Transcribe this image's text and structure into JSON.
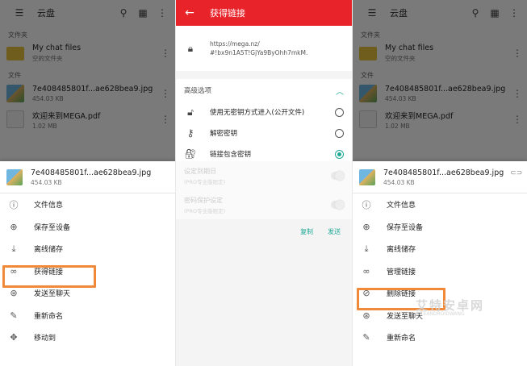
{
  "left": {
    "topbar": {
      "title": "云盘"
    },
    "folders_label": "文件夹",
    "folder": {
      "name": "My chat files",
      "meta": "空的文件夹"
    },
    "files_label": "文件",
    "files": [
      {
        "name": "7e408485801f...ae628bea9.jpg",
        "meta": "454.03 KB"
      },
      {
        "name": "欢迎来到MEGA.pdf",
        "meta": "1.02 MB"
      }
    ],
    "sheet": {
      "file_name": "7e408485801f...ae628bea9.jpg",
      "file_size": "454.03 KB",
      "items": [
        {
          "icon": "info-icon",
          "label": "文件信息"
        },
        {
          "icon": "download-icon",
          "label": "保存至设备"
        },
        {
          "icon": "offline-icon",
          "label": "离线储存"
        },
        {
          "icon": "link-icon",
          "label": "获得链接"
        },
        {
          "icon": "send-icon",
          "label": "发送至聊天"
        },
        {
          "icon": "rename-icon",
          "label": "重新命名"
        },
        {
          "icon": "move-icon",
          "label": "移动到"
        }
      ]
    }
  },
  "middle": {
    "title": "获得链接",
    "link_line1": "https://mega.nz/",
    "link_line2": "#!bx9n1A5T!GjYa9ByOhh7mkM.",
    "advanced_label": "高级选项",
    "options": [
      {
        "label": "使用无密钥方式进入(公开文件)",
        "selected": false
      },
      {
        "label": "解密密钥",
        "selected": false
      },
      {
        "label": "链接包含密钥",
        "selected": true
      }
    ],
    "pro_options": [
      {
        "label": "设定到期日",
        "note": "(PRO专业版限定)"
      },
      {
        "label": "密码保护设定",
        "note": "(PRO专业版限定)"
      }
    ],
    "copy_label": "复制",
    "send_label": "发送"
  },
  "right": {
    "topbar": {
      "title": "云盘"
    },
    "folders_label": "文件夹",
    "folder": {
      "name": "My chat files",
      "meta": "空的文件夹"
    },
    "files_label": "文件",
    "files": [
      {
        "name": "7e408485801f...ae628bea9.jpg",
        "meta": "454.03 KB"
      },
      {
        "name": "欢迎来到MEGA.pdf",
        "meta": "1.02 MB"
      }
    ],
    "sheet": {
      "file_name": "7e408485801f...ae628bea9.jpg",
      "file_size": "454.03 KB",
      "items": [
        {
          "icon": "info-icon",
          "label": "文件信息"
        },
        {
          "icon": "download-icon",
          "label": "保存至设备"
        },
        {
          "icon": "offline-icon",
          "label": "离线储存"
        },
        {
          "icon": "link-icon",
          "label": "管理链接"
        },
        {
          "icon": "unlink-icon",
          "label": "删除链接"
        },
        {
          "icon": "send-icon",
          "label": "发送至聊天"
        },
        {
          "icon": "rename-icon",
          "label": "重新命名"
        }
      ]
    }
  },
  "watermark": {
    "text": "艾特安卓网",
    "sub": "AITEANDROIDWANG"
  },
  "colors": {
    "accent": "#1ea896",
    "brand_red": "#e8232a",
    "highlight": "#f08a3a"
  }
}
